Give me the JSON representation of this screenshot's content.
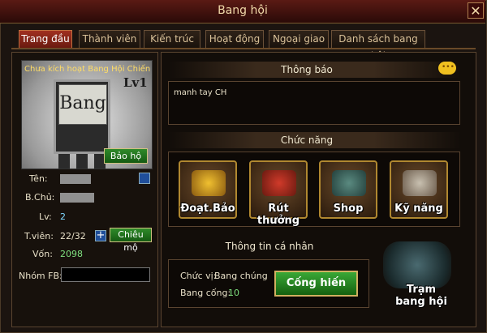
{
  "window": {
    "title": "Bang hội",
    "close_label": "✕"
  },
  "tabs": [
    {
      "label": "Trang đầu",
      "active": true
    },
    {
      "label": "Thành viên",
      "active": false
    },
    {
      "label": "Kiến trúc",
      "active": false
    },
    {
      "label": "Hoạt động",
      "active": false
    },
    {
      "label": "Ngoại giao",
      "active": false
    },
    {
      "label": "Danh sách bang hội",
      "active": false
    }
  ],
  "guild": {
    "emblem_title": "Chưa kích hoạt Bang Hội Chiến",
    "emblem_text": "Bang",
    "level_badge": "Lv1",
    "protect_button": "Bảo hộ",
    "name_label": "Tên:",
    "leader_label": "B.Chủ:",
    "level_label": "Lv:",
    "level_value": "2",
    "members_label": "T.viên:",
    "members_value": "22/32",
    "add_icon": "+",
    "recruit_button": "Chiêu mộ",
    "funds_label": "Vốn:",
    "funds_value": "2098",
    "fb_group_label": "Nhóm FB:"
  },
  "notice": {
    "heading": "Thông báo",
    "text": "manh tay CH"
  },
  "functions": {
    "heading": "Chức năng",
    "items": [
      {
        "label": "Đoạt.Bảo",
        "icon": "treasure-pot-icon"
      },
      {
        "label": "Rút thưởng",
        "icon": "reward-chest-icon"
      },
      {
        "label": "Shop",
        "icon": "shop-building-icon"
      },
      {
        "label": "Kỹ năng",
        "icon": "skill-palace-icon"
      }
    ]
  },
  "personal": {
    "heading": "Thông tin cá nhân",
    "position_label": "Chức vị:",
    "position_value": "Bang chúng",
    "contribution_label": "Bang cống:",
    "contribution_value": "10",
    "contribute_button": "Cống hiến"
  },
  "station": {
    "label_line1": "Trạm",
    "label_line2": "bang hội"
  },
  "colors": {
    "accent_red": "#a03020",
    "value_cyan": "#7fd8ff",
    "button_green": "#2f8a2a",
    "gold": "#ffdd66"
  }
}
